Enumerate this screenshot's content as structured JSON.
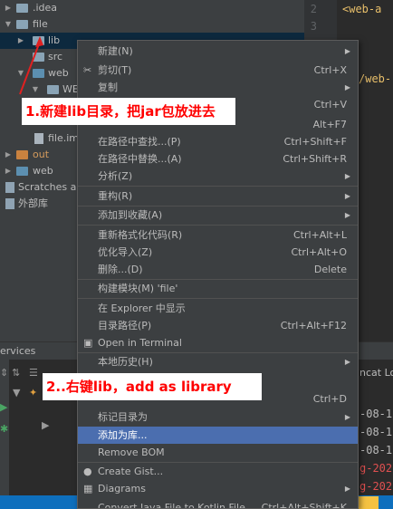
{
  "tree": {
    "items": [
      {
        "label": ".idea",
        "indent": 0,
        "open": false
      },
      {
        "label": "file",
        "indent": 0,
        "open": true
      },
      {
        "label": "lib",
        "indent": 1,
        "open": false
      },
      {
        "label": "src",
        "indent": 1,
        "open": false
      },
      {
        "label": "web",
        "indent": 1,
        "open": true
      },
      {
        "label": "WE",
        "indent": 2,
        "open": true
      },
      {
        "label": "file.im",
        "indent": 1,
        "open": false
      },
      {
        "label": "out",
        "indent": 0,
        "open": false
      },
      {
        "label": "web",
        "indent": 0,
        "open": false
      },
      {
        "label": "Scratches an",
        "indent": 0,
        "open": false
      },
      {
        "label": "外部库",
        "indent": 0,
        "open": false
      }
    ]
  },
  "editor": {
    "line_numbers": [
      "2",
      "3"
    ],
    "code_lines": [
      "<web-a",
      "/web-"
    ]
  },
  "services": {
    "title": "ervices",
    "tomcat_location": "ncat Loca",
    "log_dates": [
      "-08-1",
      "-08-1",
      "-08-1",
      "g-202",
      "g-202"
    ]
  },
  "menu": {
    "items": [
      {
        "label": "新建(N)",
        "shortcut": "",
        "submenu": true
      },
      {
        "label": "剪切(T)",
        "shortcut": "Ctrl+X",
        "submenu": false,
        "icon": "cut-icon"
      },
      {
        "label": "复制",
        "shortcut": "",
        "submenu": true
      },
      {
        "label": "",
        "shortcut": "Ctrl+V",
        "submenu": false
      },
      {
        "label": "",
        "shortcut": "Alt+F7",
        "submenu": false
      },
      {
        "label": "在路径中查找...(P)",
        "shortcut": "Ctrl+Shift+F",
        "submenu": false
      },
      {
        "label": "在路径中替换...(A)",
        "shortcut": "Ctrl+Shift+R",
        "submenu": false
      },
      {
        "label": "分析(Z)",
        "shortcut": "",
        "submenu": true
      },
      {
        "label": "重构(R)",
        "shortcut": "",
        "submenu": true
      },
      {
        "label": "添加到收藏(A)",
        "shortcut": "",
        "submenu": true
      },
      {
        "label": "重新格式化代码(R)",
        "shortcut": "Ctrl+Alt+L",
        "submenu": false
      },
      {
        "label": "优化导入(Z)",
        "shortcut": "Ctrl+Alt+O",
        "submenu": false
      },
      {
        "label": "删除...(D)",
        "shortcut": "Delete",
        "submenu": false
      },
      {
        "label": "构建模块(M) 'file'",
        "shortcut": "",
        "submenu": false
      },
      {
        "label": "在 Explorer 中显示",
        "shortcut": "",
        "submenu": false
      },
      {
        "label": "目录路径(P)",
        "shortcut": "Ctrl+Alt+F12",
        "submenu": false
      },
      {
        "label": "Open in Terminal",
        "shortcut": "",
        "submenu": false,
        "icon": "terminal-icon"
      },
      {
        "label": "本地历史(H)",
        "shortcut": "",
        "submenu": true
      },
      {
        "label": "",
        "shortcut": "Ctrl+D",
        "submenu": false
      },
      {
        "label": "标记目录为",
        "shortcut": "",
        "submenu": true
      },
      {
        "label": "添加为库...",
        "shortcut": "",
        "submenu": false,
        "highlighted": true
      },
      {
        "label": "Remove BOM",
        "shortcut": "",
        "submenu": false
      },
      {
        "label": "Create Gist...",
        "shortcut": "",
        "submenu": false,
        "icon": "github-icon"
      },
      {
        "label": "Diagrams",
        "shortcut": "",
        "submenu": true,
        "icon": "diagram-icon"
      },
      {
        "label": "Convert Java File to Kotlin File",
        "shortcut": "Ctrl+Alt+Shift+K",
        "submenu": false
      }
    ]
  },
  "annotations": {
    "step1": "1.新建lib目录，把jar包放进去",
    "step2": "2..右键lib，add as library"
  },
  "colors": {
    "accent": "#4b6eaf",
    "annotation_red": "#ff0000",
    "statusbar": "#0e6fbd"
  }
}
